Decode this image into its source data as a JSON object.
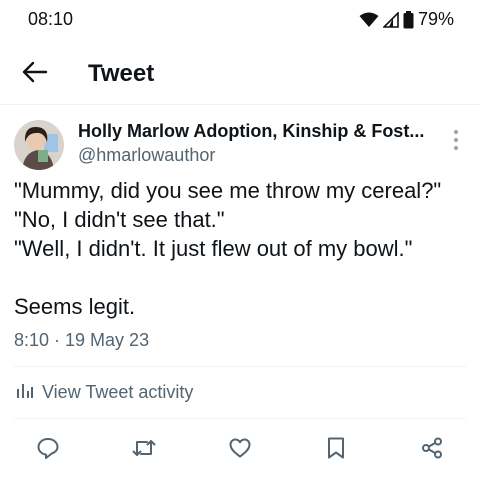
{
  "status_bar": {
    "time": "08:10",
    "battery": "79%"
  },
  "header": {
    "title": "Tweet"
  },
  "tweet": {
    "author_name": "Holly Marlow Adoption, Kinship & Fost...",
    "author_handle": "@hmarlowauthor",
    "text_lines": [
      "\"Mummy, did you see me throw my cereal?\"",
      "\"No, I didn't see that.\"",
      "\"Well, I didn't. It just flew out of my bowl.\"",
      "Seems legit."
    ],
    "timestamp": "8:10 · 19 May 23"
  },
  "activity": {
    "label": "View Tweet activity"
  },
  "actions": {
    "icons": [
      "reply-icon",
      "retweet-icon",
      "like-icon",
      "bookmark-icon",
      "share-icon"
    ]
  },
  "colors": {
    "text": "#0f1419",
    "secondary": "#536471",
    "divider": "#eff3f4"
  }
}
